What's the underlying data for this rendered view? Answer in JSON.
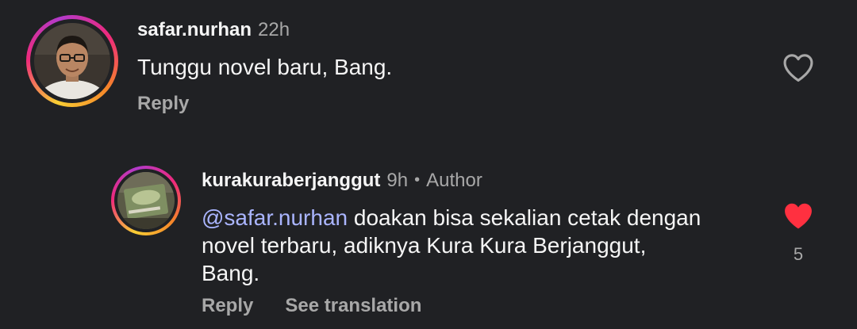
{
  "comments": [
    {
      "username": "safar.nurhan",
      "time": "22h",
      "text": "Tunggu novel baru, Bang.",
      "reply_label": "Reply",
      "liked": false
    },
    {
      "username": "kurakuraberjanggut",
      "time": "9h",
      "separator": "•",
      "badge": "Author",
      "mention": "@safar.nurhan",
      "text_line1": " doakan bisa sekalian cetak dengan",
      "text_line2": "novel terbaru, adiknya Kura Kura Berjanggut,",
      "text_line3": "Bang.",
      "reply_label": "Reply",
      "translate_label": "See translation",
      "liked": true,
      "like_count": "5"
    }
  ],
  "colors": {
    "background": "#202124",
    "mention": "#aab5ff",
    "liked_heart": "#ff3040",
    "muted": "#a8a8a8"
  },
  "icons": {
    "like_empty": "heart-outline-icon",
    "like_filled": "heart-filled-icon"
  }
}
